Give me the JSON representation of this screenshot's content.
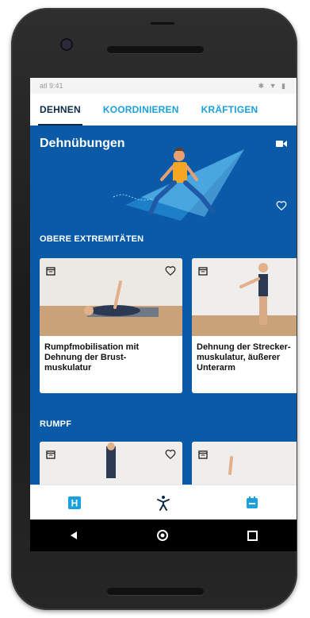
{
  "status_bar": {
    "carrier": "atl",
    "time": "9:41",
    "icons": "✱ ▼ ▮"
  },
  "tabs": [
    {
      "label": "DEHNEN",
      "active": true
    },
    {
      "label": "KOORDINIEREN",
      "active": false
    },
    {
      "label": "KRÄFTIGEN",
      "active": false
    }
  ],
  "hero": {
    "title": "Dehnübungen",
    "video_icon": "videocam-icon",
    "heart_icon": "heart-outline-icon"
  },
  "sections": [
    {
      "label": "OBERE EXTREMITÄTEN",
      "cards": [
        {
          "title_lines": [
            "Rumpfmobilisation mit",
            "Dehnung der Brust-",
            "muskulatur"
          ]
        },
        {
          "title_lines": [
            "Dehnung der Strecker-",
            "muskulatur, äußerer",
            "Unterarm"
          ]
        }
      ]
    },
    {
      "label": "RUMPF",
      "cards": [
        {
          "title_lines": []
        },
        {
          "title_lines": []
        }
      ]
    }
  ],
  "bottom_nav": [
    {
      "name": "home-h-icon",
      "label": "H"
    },
    {
      "name": "exercise-figure-icon"
    },
    {
      "name": "calendar-icon"
    }
  ],
  "android_nav": [
    "back-icon",
    "home-icon",
    "recents-icon"
  ],
  "colors": {
    "primary_blue": "#0a5aa8",
    "accent_blue": "#1aa0dd",
    "tab_active": "#0d2a4a",
    "illus_orange": "#f5a623"
  }
}
